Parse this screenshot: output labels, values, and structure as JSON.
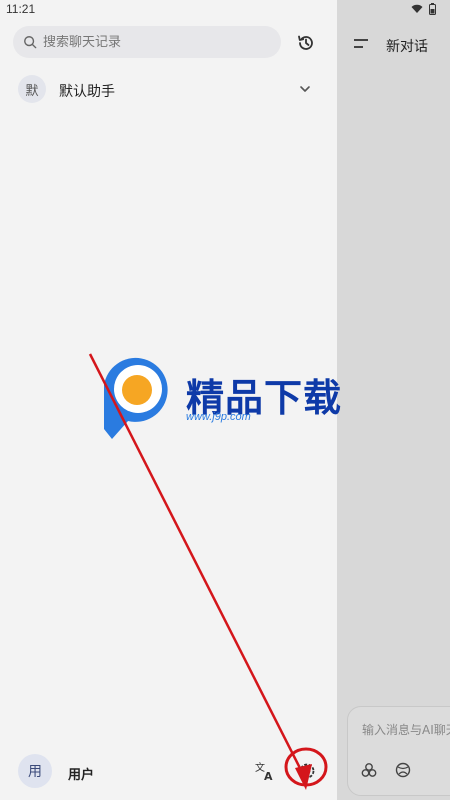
{
  "status_bar": {
    "time": "11:21"
  },
  "drawer": {
    "search": {
      "placeholder": "搜索聊天记录"
    },
    "assistant": {
      "avatar_text": "默",
      "name": "默认助手"
    },
    "user": {
      "avatar_text": "用",
      "name": "用户"
    }
  },
  "right_panel": {
    "title": "新对话",
    "input_placeholder": "输入消息与AI聊天"
  },
  "watermark": {
    "title": "精品下载",
    "url": "www.j9p.com"
  },
  "colors": {
    "annotation": "#d4161b",
    "brand_blue": "#0e3aa8",
    "logo_orange": "#f6a623"
  }
}
